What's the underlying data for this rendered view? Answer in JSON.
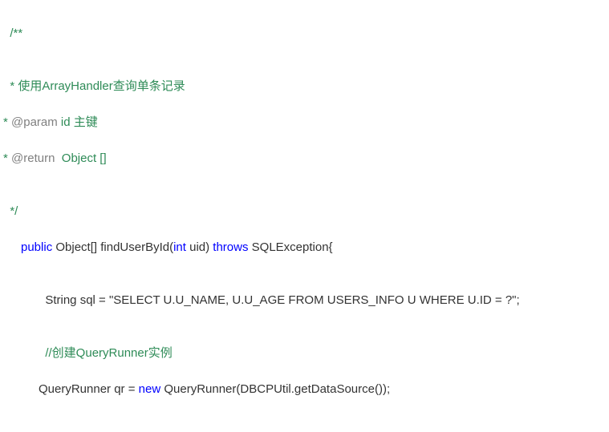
{
  "lines": {
    "l1": "/**",
    "l2": "* 使用ArrayHandler查询单条记录",
    "l3a": "* ",
    "l3b": "@param",
    "l3c": " id 主键",
    "l4a": "* ",
    "l4b": "@return",
    "l4c": "  Object []",
    "l5": "*/",
    "l6a": "public",
    "l6b": " Object[] findUserById(",
    "l6c": "int",
    "l6d": " uid) ",
    "l6e": "throws",
    "l6f": " SQLException{",
    "l7": "String sql = \"SELECT U.U_NAME, U.U_AGE FROM USERS_INFO U WHERE U.ID = ?\";",
    "l8": "//创建QueryRunner实例",
    "l9a": "QueryRunner qr = ",
    "l9b": "new",
    "l9c": " QueryRunner(DBCPUtil.getDataSource());"
  }
}
